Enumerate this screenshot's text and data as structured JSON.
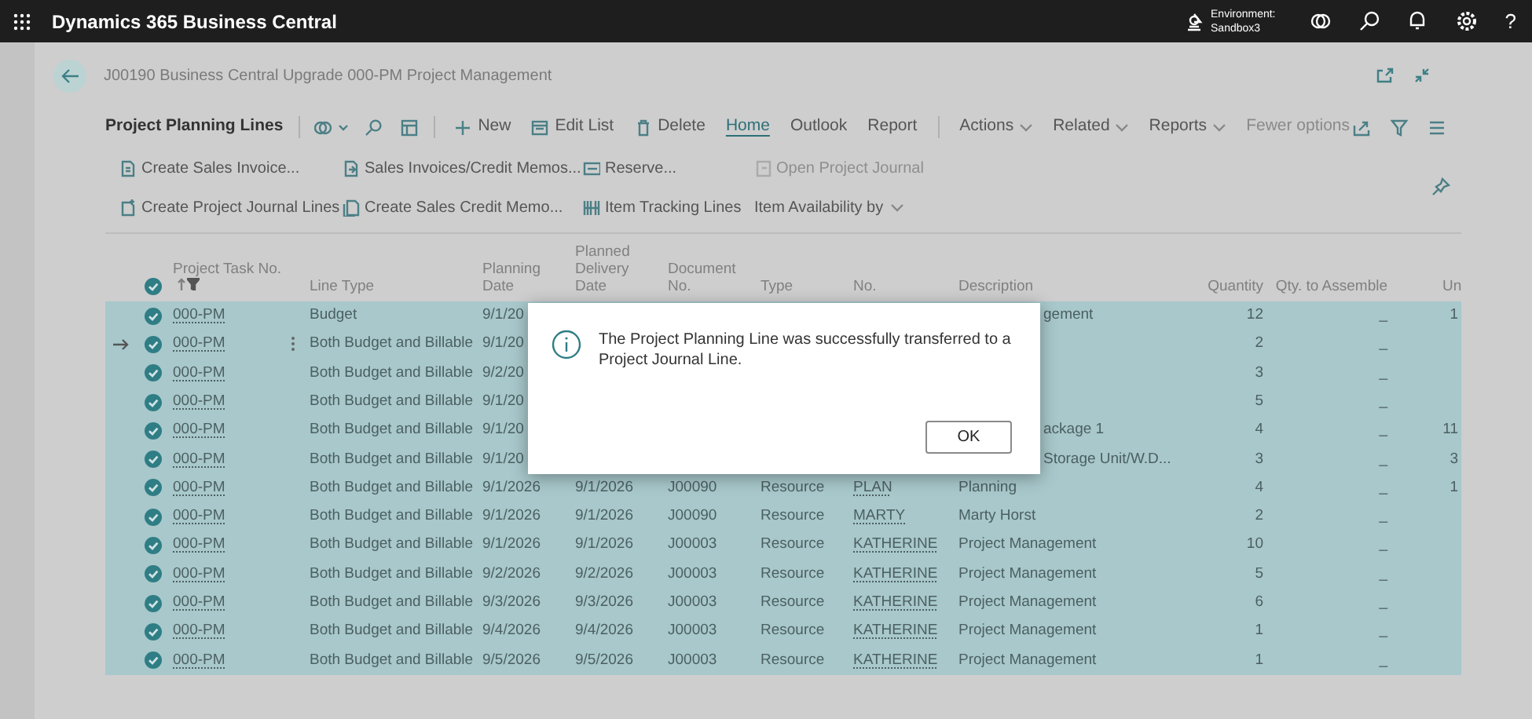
{
  "app_bar": {
    "title": "Dynamics 365 Business Central",
    "environment_label": "Environment:",
    "environment_name": "Sandbox3",
    "help": "?"
  },
  "page": {
    "title": "J00190 Business Central Upgrade 000-PM Project Management"
  },
  "action_bar": {
    "title": "Project Planning Lines",
    "items": [
      {
        "kind": "new",
        "label": "New"
      },
      {
        "kind": "edit",
        "label": "Edit List"
      },
      {
        "kind": "delete",
        "label": "Delete"
      },
      {
        "kind": "tab",
        "label": "Home",
        "selected": true
      },
      {
        "kind": "tab",
        "label": "Outlook",
        "selected": false
      },
      {
        "kind": "tab",
        "label": "Report",
        "selected": false
      }
    ],
    "menus": [
      "Actions",
      "Related",
      "Reports"
    ],
    "fewer_options": "Fewer options"
  },
  "promoted_actions": [
    [
      {
        "kind": "invoice",
        "label": "Create Sales Invoice...",
        "disabled": false
      },
      {
        "kind": "memos",
        "label": "Sales Invoices/Credit Memos...",
        "disabled": false
      },
      {
        "kind": "reserve",
        "label": "Reserve...",
        "disabled": false
      },
      {
        "kind": "journal",
        "label": "Open Project Journal",
        "disabled": true
      }
    ],
    [
      {
        "kind": "lines",
        "label": "Create Project Journal Lines",
        "disabled": false
      },
      {
        "kind": "credit",
        "label": "Create Sales Credit Memo...",
        "disabled": false
      },
      {
        "kind": "tracking",
        "label": "Item Tracking Lines",
        "disabled": false
      },
      {
        "kind": "menu",
        "label": "Item Availability by",
        "disabled": false
      }
    ]
  ],
  "table": {
    "all_selected": true,
    "columns": [
      {
        "label": "Project Task No.",
        "sorted": true,
        "filtered": true
      },
      {
        "label": "Line Type"
      },
      {
        "label": "Planning Date"
      },
      {
        "label": "Planned Delivery Date"
      },
      {
        "label": "Document No."
      },
      {
        "label": "Type"
      },
      {
        "label": "No."
      },
      {
        "label": "Description"
      },
      {
        "label": "Quantity"
      },
      {
        "label": "Qty. to Assemble"
      },
      {
        "label": "Un"
      }
    ],
    "rows": [
      {
        "selected": true,
        "current": false,
        "partly_covered": true,
        "task": "000-PM",
        "line_type": "Budget",
        "planning_date": "9/1/20",
        "description": "gement",
        "quantity": "12",
        "qty_to_assemble": "_",
        "unit": "1"
      },
      {
        "selected": true,
        "current": true,
        "task": "000-PM",
        "line_type": "Both Budget and Billable",
        "planning_date": "9/1/20",
        "quantity": "2",
        "qty_to_assemble": "_"
      },
      {
        "selected": true,
        "current": false,
        "task": "000-PM",
        "line_type": "Both Budget and Billable",
        "planning_date": "9/2/20",
        "quantity": "3",
        "qty_to_assemble": "_"
      },
      {
        "selected": true,
        "current": false,
        "task": "000-PM",
        "line_type": "Both Budget and Billable",
        "planning_date": "9/1/20",
        "quantity": "5",
        "qty_to_assemble": "_"
      },
      {
        "selected": true,
        "current": false,
        "partly_covered": true,
        "task": "000-PM",
        "line_type": "Both Budget and Billable",
        "planning_date": "9/1/20",
        "description": "ackage 1",
        "quantity": "4",
        "qty_to_assemble": "_",
        "unit": "11"
      },
      {
        "selected": true,
        "current": false,
        "partly_covered": true,
        "task": "000-PM",
        "line_type": "Both Budget and Billable",
        "planning_date": "9/1/20",
        "description": "Storage Unit/W.D...",
        "quantity": "3",
        "qty_to_assemble": "_",
        "unit": "3"
      },
      {
        "selected": true,
        "current": false,
        "task": "000-PM",
        "line_type": "Both Budget and Billable",
        "planning_date": "9/1/2026",
        "planned_delivery_date": "9/1/2026",
        "document_no": "J00090",
        "type": "Resource",
        "no": "PLAN",
        "description": "Planning",
        "quantity": "4",
        "qty_to_assemble": "_",
        "unit": "1"
      },
      {
        "selected": true,
        "current": false,
        "task": "000-PM",
        "line_type": "Both Budget and Billable",
        "planning_date": "9/1/2026",
        "planned_delivery_date": "9/1/2026",
        "document_no": "J00090",
        "type": "Resource",
        "no": "MARTY",
        "description": "Marty Horst",
        "quantity": "2",
        "qty_to_assemble": "_"
      },
      {
        "selected": true,
        "current": false,
        "task": "000-PM",
        "line_type": "Both Budget and Billable",
        "planning_date": "9/1/2026",
        "planned_delivery_date": "9/1/2026",
        "document_no": "J00003",
        "type": "Resource",
        "no": "KATHERINE",
        "description": "Project Management",
        "quantity": "10",
        "qty_to_assemble": "_"
      },
      {
        "selected": true,
        "current": false,
        "task": "000-PM",
        "line_type": "Both Budget and Billable",
        "planning_date": "9/2/2026",
        "planned_delivery_date": "9/2/2026",
        "document_no": "J00003",
        "type": "Resource",
        "no": "KATHERINE",
        "description": "Project Management",
        "quantity": "5",
        "qty_to_assemble": "_"
      },
      {
        "selected": true,
        "current": false,
        "task": "000-PM",
        "line_type": "Both Budget and Billable",
        "planning_date": "9/3/2026",
        "planned_delivery_date": "9/3/2026",
        "document_no": "J00003",
        "type": "Resource",
        "no": "KATHERINE",
        "description": "Project Management",
        "quantity": "6",
        "qty_to_assemble": "_"
      },
      {
        "selected": true,
        "current": false,
        "task": "000-PM",
        "line_type": "Both Budget and Billable",
        "planning_date": "9/4/2026",
        "planned_delivery_date": "9/4/2026",
        "document_no": "J00003",
        "type": "Resource",
        "no": "KATHERINE",
        "description": "Project Management",
        "quantity": "1",
        "qty_to_assemble": "_"
      },
      {
        "selected": true,
        "current": false,
        "task": "000-PM",
        "line_type": "Both Budget and Billable",
        "planning_date": "9/5/2026",
        "planned_delivery_date": "9/5/2026",
        "document_no": "J00003",
        "type": "Resource",
        "no": "KATHERINE",
        "description": "Project Management",
        "quantity": "1",
        "qty_to_assemble": "_"
      }
    ]
  },
  "dialog": {
    "message": "The Project Planning Line was successfully transferred to a Project Journal Line.",
    "button": "OK"
  }
}
